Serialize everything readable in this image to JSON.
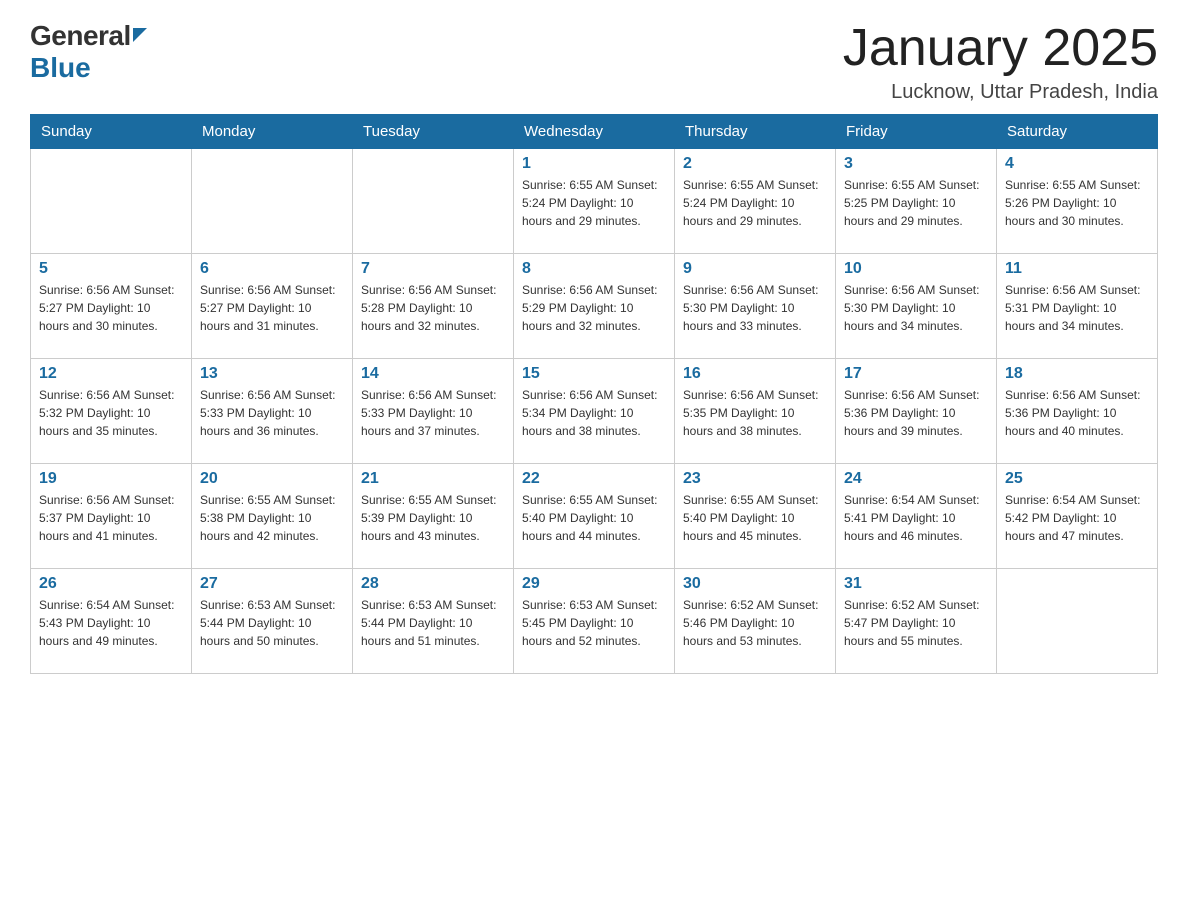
{
  "header": {
    "logo_general": "General",
    "logo_blue": "Blue",
    "title": "January 2025",
    "subtitle": "Lucknow, Uttar Pradesh, India"
  },
  "days_of_week": [
    "Sunday",
    "Monday",
    "Tuesday",
    "Wednesday",
    "Thursday",
    "Friday",
    "Saturday"
  ],
  "weeks": [
    [
      {
        "day": "",
        "info": ""
      },
      {
        "day": "",
        "info": ""
      },
      {
        "day": "",
        "info": ""
      },
      {
        "day": "1",
        "info": "Sunrise: 6:55 AM\nSunset: 5:24 PM\nDaylight: 10 hours\nand 29 minutes."
      },
      {
        "day": "2",
        "info": "Sunrise: 6:55 AM\nSunset: 5:24 PM\nDaylight: 10 hours\nand 29 minutes."
      },
      {
        "day": "3",
        "info": "Sunrise: 6:55 AM\nSunset: 5:25 PM\nDaylight: 10 hours\nand 29 minutes."
      },
      {
        "day": "4",
        "info": "Sunrise: 6:55 AM\nSunset: 5:26 PM\nDaylight: 10 hours\nand 30 minutes."
      }
    ],
    [
      {
        "day": "5",
        "info": "Sunrise: 6:56 AM\nSunset: 5:27 PM\nDaylight: 10 hours\nand 30 minutes."
      },
      {
        "day": "6",
        "info": "Sunrise: 6:56 AM\nSunset: 5:27 PM\nDaylight: 10 hours\nand 31 minutes."
      },
      {
        "day": "7",
        "info": "Sunrise: 6:56 AM\nSunset: 5:28 PM\nDaylight: 10 hours\nand 32 minutes."
      },
      {
        "day": "8",
        "info": "Sunrise: 6:56 AM\nSunset: 5:29 PM\nDaylight: 10 hours\nand 32 minutes."
      },
      {
        "day": "9",
        "info": "Sunrise: 6:56 AM\nSunset: 5:30 PM\nDaylight: 10 hours\nand 33 minutes."
      },
      {
        "day": "10",
        "info": "Sunrise: 6:56 AM\nSunset: 5:30 PM\nDaylight: 10 hours\nand 34 minutes."
      },
      {
        "day": "11",
        "info": "Sunrise: 6:56 AM\nSunset: 5:31 PM\nDaylight: 10 hours\nand 34 minutes."
      }
    ],
    [
      {
        "day": "12",
        "info": "Sunrise: 6:56 AM\nSunset: 5:32 PM\nDaylight: 10 hours\nand 35 minutes."
      },
      {
        "day": "13",
        "info": "Sunrise: 6:56 AM\nSunset: 5:33 PM\nDaylight: 10 hours\nand 36 minutes."
      },
      {
        "day": "14",
        "info": "Sunrise: 6:56 AM\nSunset: 5:33 PM\nDaylight: 10 hours\nand 37 minutes."
      },
      {
        "day": "15",
        "info": "Sunrise: 6:56 AM\nSunset: 5:34 PM\nDaylight: 10 hours\nand 38 minutes."
      },
      {
        "day": "16",
        "info": "Sunrise: 6:56 AM\nSunset: 5:35 PM\nDaylight: 10 hours\nand 38 minutes."
      },
      {
        "day": "17",
        "info": "Sunrise: 6:56 AM\nSunset: 5:36 PM\nDaylight: 10 hours\nand 39 minutes."
      },
      {
        "day": "18",
        "info": "Sunrise: 6:56 AM\nSunset: 5:36 PM\nDaylight: 10 hours\nand 40 minutes."
      }
    ],
    [
      {
        "day": "19",
        "info": "Sunrise: 6:56 AM\nSunset: 5:37 PM\nDaylight: 10 hours\nand 41 minutes."
      },
      {
        "day": "20",
        "info": "Sunrise: 6:55 AM\nSunset: 5:38 PM\nDaylight: 10 hours\nand 42 minutes."
      },
      {
        "day": "21",
        "info": "Sunrise: 6:55 AM\nSunset: 5:39 PM\nDaylight: 10 hours\nand 43 minutes."
      },
      {
        "day": "22",
        "info": "Sunrise: 6:55 AM\nSunset: 5:40 PM\nDaylight: 10 hours\nand 44 minutes."
      },
      {
        "day": "23",
        "info": "Sunrise: 6:55 AM\nSunset: 5:40 PM\nDaylight: 10 hours\nand 45 minutes."
      },
      {
        "day": "24",
        "info": "Sunrise: 6:54 AM\nSunset: 5:41 PM\nDaylight: 10 hours\nand 46 minutes."
      },
      {
        "day": "25",
        "info": "Sunrise: 6:54 AM\nSunset: 5:42 PM\nDaylight: 10 hours\nand 47 minutes."
      }
    ],
    [
      {
        "day": "26",
        "info": "Sunrise: 6:54 AM\nSunset: 5:43 PM\nDaylight: 10 hours\nand 49 minutes."
      },
      {
        "day": "27",
        "info": "Sunrise: 6:53 AM\nSunset: 5:44 PM\nDaylight: 10 hours\nand 50 minutes."
      },
      {
        "day": "28",
        "info": "Sunrise: 6:53 AM\nSunset: 5:44 PM\nDaylight: 10 hours\nand 51 minutes."
      },
      {
        "day": "29",
        "info": "Sunrise: 6:53 AM\nSunset: 5:45 PM\nDaylight: 10 hours\nand 52 minutes."
      },
      {
        "day": "30",
        "info": "Sunrise: 6:52 AM\nSunset: 5:46 PM\nDaylight: 10 hours\nand 53 minutes."
      },
      {
        "day": "31",
        "info": "Sunrise: 6:52 AM\nSunset: 5:47 PM\nDaylight: 10 hours\nand 55 minutes."
      },
      {
        "day": "",
        "info": ""
      }
    ]
  ]
}
